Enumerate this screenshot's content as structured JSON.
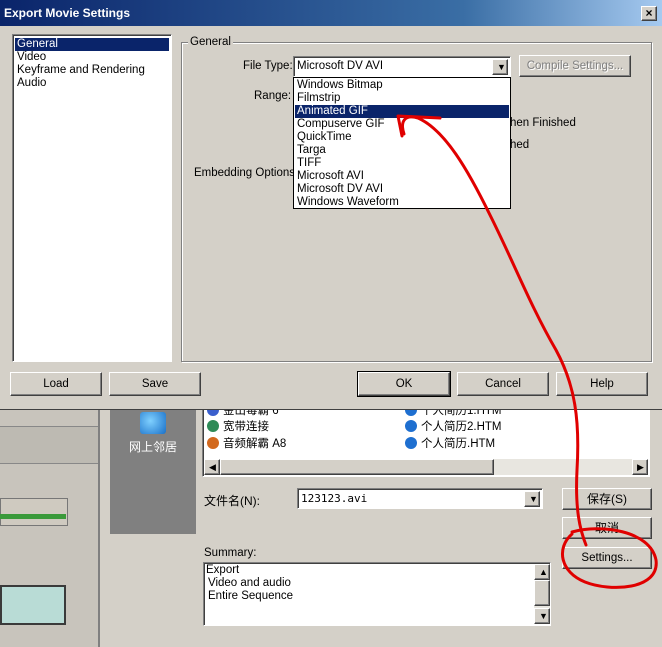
{
  "dialog": {
    "title": "Export Movie Settings",
    "close_glyph": "×",
    "categories": [
      {
        "label": "General",
        "selected": true
      },
      {
        "label": "Video",
        "selected": false
      },
      {
        "label": "Keyframe and Rendering",
        "selected": false
      },
      {
        "label": "Audio",
        "selected": false
      }
    ],
    "group_title": "General",
    "file_type_label": "File Type:",
    "file_type_value": "Microsoft DV AVI",
    "range_label": "Range:",
    "embedding_label": "Embedding Options:",
    "compile_settings": "Compile Settings...",
    "when_finished_1": "hen Finished",
    "when_finished_2": "hed",
    "dropdown_options": [
      {
        "label": "Windows Bitmap",
        "selected": false
      },
      {
        "label": "Filmstrip",
        "selected": false
      },
      {
        "label": "Animated GIF",
        "selected": true
      },
      {
        "label": "Compuserve GIF",
        "selected": false
      },
      {
        "label": "QuickTime",
        "selected": false
      },
      {
        "label": "Targa",
        "selected": false
      },
      {
        "label": "TIFF",
        "selected": false
      },
      {
        "label": "Microsoft AVI",
        "selected": false
      },
      {
        "label": "Microsoft DV AVI",
        "selected": false
      },
      {
        "label": "Windows Waveform",
        "selected": false
      }
    ],
    "buttons": {
      "load": "Load",
      "save": "Save",
      "ok": "OK",
      "cancel": "Cancel",
      "help": "Help"
    }
  },
  "save_dialog": {
    "network_places": "网上邻居",
    "files": [
      {
        "name": "金山毒霸 6",
        "color": "#3a5fcd"
      },
      {
        "name": "宽带连接",
        "color": "#2e8b57"
      },
      {
        "name": "音频解霸 A8",
        "color": "#d2691e"
      },
      {
        "name": "个人简历1.HTM",
        "color": "#1e6fd0"
      },
      {
        "name": "个人简历2.HTM",
        "color": "#1e6fd0"
      },
      {
        "name": "个人简历.HTM",
        "color": "#1e6fd0"
      }
    ],
    "filename_label": "文件名(N):",
    "filename_value": "123123.avi",
    "save_button": "保存(S)",
    "cancel_button": "取消",
    "settings_button": "Settings...",
    "summary_label": "Summary:",
    "summary_lines": [
      "Export",
      "Video and audio",
      "Entire Sequence"
    ]
  },
  "annotation": {
    "color": "#e00000"
  }
}
